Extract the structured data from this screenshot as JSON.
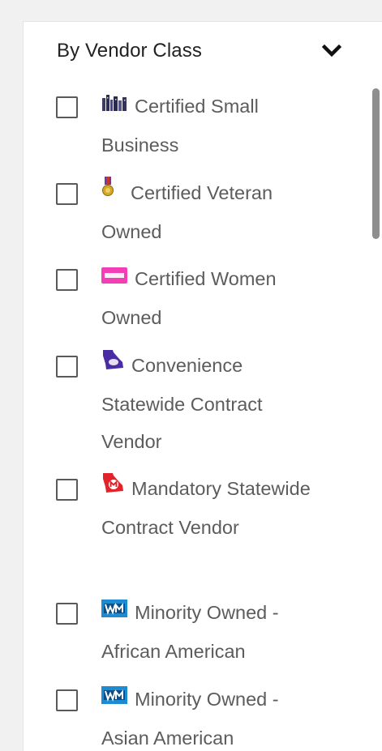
{
  "filter": {
    "title": "By Vendor Class",
    "chevron_icon": "chevron-down-icon"
  },
  "items": [
    {
      "label": "Certified Small Business",
      "icon": "small-business-icon",
      "checked": false
    },
    {
      "label": "Certified Veteran Owned",
      "icon": "veteran-medal-icon",
      "checked": false
    },
    {
      "label": "Certified Women Owned",
      "icon": "wbe-icon",
      "checked": false
    },
    {
      "label": "Convenience Statewide Contract Vendor",
      "icon": "georgia-convenience-icon",
      "checked": false
    },
    {
      "label": "Mandatory Statewide Contract Vendor",
      "icon": "georgia-mandatory-icon",
      "checked": false
    },
    {
      "label": "Minority Owned - African American",
      "icon": "minority-owned-icon",
      "checked": false
    },
    {
      "label": "Minority Owned - Asian American",
      "icon": "minority-owned-icon",
      "checked": false
    }
  ],
  "colors": {
    "wbe": "#f23fb6",
    "convenience": "#4a2ca3",
    "mandatory": "#e2232a",
    "minority": "#1d8bd1",
    "veteran_ribbon": "#6b3aa0",
    "veteran_medal": "#d6a82a"
  }
}
